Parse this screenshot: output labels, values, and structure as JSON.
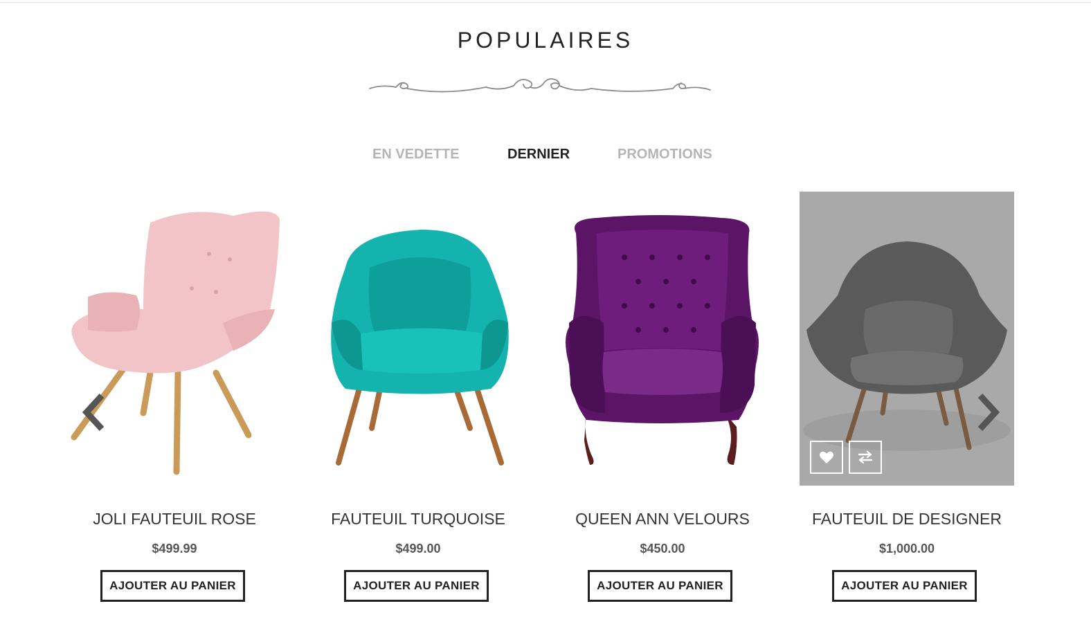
{
  "section": {
    "title": "POPULAIRES"
  },
  "tabs": [
    {
      "label": "EN VEDETTE",
      "active": false
    },
    {
      "label": "DERNIER",
      "active": true
    },
    {
      "label": "PROMOTIONS",
      "active": false
    }
  ],
  "products": [
    {
      "name": "JOLI FAUTEUIL ROSE",
      "price": "$499.99",
      "cart_label": "AJOUTER AU PANIER",
      "image": "pink-armchair"
    },
    {
      "name": "FAUTEUIL TURQUOISE",
      "price": "$499.00",
      "cart_label": "AJOUTER AU PANIER",
      "image": "turquoise-armchair"
    },
    {
      "name": "QUEEN ANN VELOURS",
      "price": "$450.00",
      "cart_label": "AJOUTER AU PANIER",
      "image": "purple-wingback-chair"
    },
    {
      "name": "FAUTEUIL DE DESIGNER",
      "price": "$1,000.00",
      "cart_label": "AJOUTER AU PANIER",
      "image": "grey-designer-chair"
    }
  ],
  "icons": {
    "prev": "chevron-left-icon",
    "next": "chevron-right-icon",
    "wishlist": "heart-icon",
    "compare": "compare-arrows-icon"
  },
  "colors": {
    "text": "#222222",
    "tab_inactive": "#b5b5b5",
    "price": "#555555",
    "hover_overlay": "#a9a9a9"
  }
}
